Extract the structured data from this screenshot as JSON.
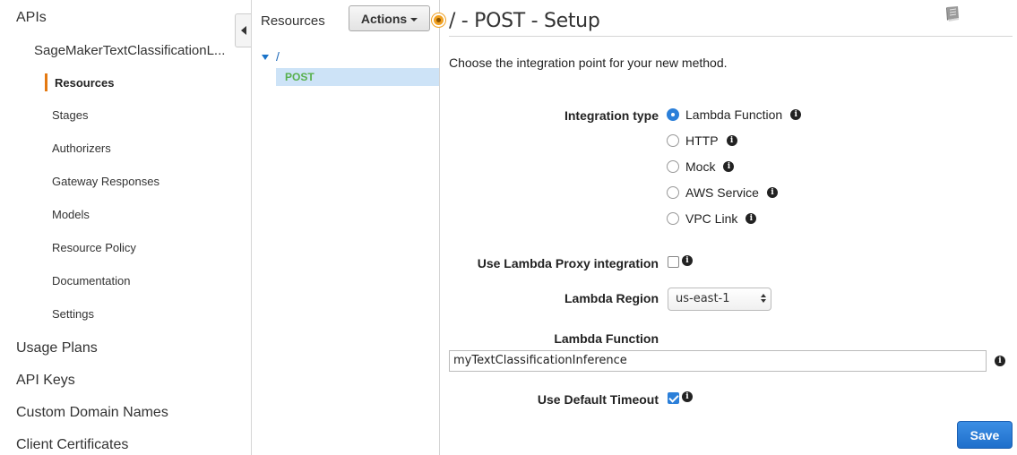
{
  "nav": {
    "apis_label": "APIs",
    "api_name": "SageMakerTextClassificationL...",
    "sub_items": [
      "Resources",
      "Stages",
      "Authorizers",
      "Gateway Responses",
      "Models",
      "Resource Policy",
      "Documentation",
      "Settings"
    ],
    "active_sub_item": "Resources",
    "top_items": [
      "Usage Plans",
      "API Keys",
      "Custom Domain Names",
      "Client Certificates"
    ]
  },
  "resources": {
    "title": "Resources",
    "actions_label": "Actions",
    "root_path": "/",
    "method": "POST"
  },
  "main": {
    "title": "/ - POST - Setup",
    "intro": "Choose the integration point for your new method.",
    "integration_type_label": "Integration type",
    "integration_options": [
      "Lambda Function",
      "HTTP",
      "Mock",
      "AWS Service",
      "VPC Link"
    ],
    "integration_selected": "Lambda Function",
    "proxy_label": "Use Lambda Proxy integration",
    "proxy_checked": false,
    "region_label": "Lambda Region",
    "region_value": "us-east-1",
    "function_label": "Lambda Function",
    "function_value": "myTextClassificationInference",
    "timeout_label": "Use Default Timeout",
    "timeout_checked": true,
    "save_label": "Save",
    "info_glyph": "i"
  },
  "colors": {
    "accent": "#2b7fd9",
    "nav_active_bar": "#e47911",
    "method_post": "#58b04d",
    "selected_row": "#cde3f7"
  }
}
